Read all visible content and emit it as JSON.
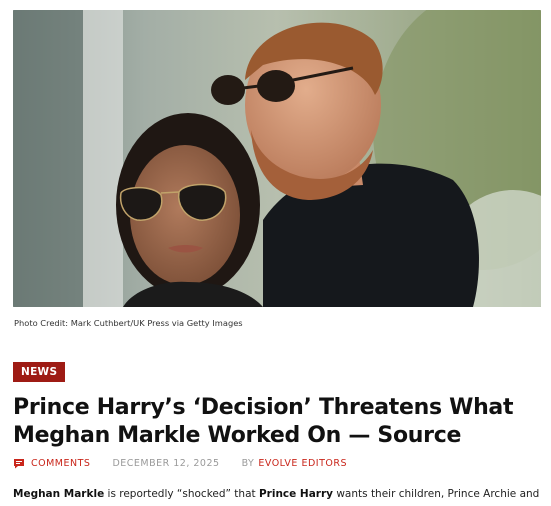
{
  "photo": {
    "credit": "Photo Credit: Mark Cuthbert/UK Press via Getty Images"
  },
  "article": {
    "category": "NEWS",
    "title": "Prince Harry’s ‘Decision’ Threatens What Meghan Markle Worked On — Source",
    "comments_label": "COMMENTS",
    "date": "DECEMBER 12, 2025",
    "by": "BY",
    "author": "EVOLVE EDITORS",
    "excerpt": {
      "name1": "Meghan Markle",
      "text1": " is reportedly “shocked” that ",
      "name2": "Prince Harry",
      "text2": " wants their children, Prince Archie and"
    }
  },
  "colors": {
    "accent": "#c9261b",
    "tag_bg": "#9e1b14",
    "meta_gray": "#9a9a9a"
  },
  "icons": {
    "comments": "comment-bubble-icon"
  }
}
